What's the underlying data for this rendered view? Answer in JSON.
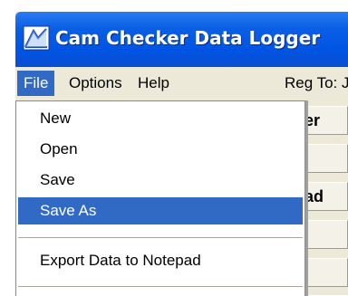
{
  "window": {
    "title": "Cam Checker Data Logger"
  },
  "menubar": {
    "items": [
      {
        "label": "File",
        "active": true
      },
      {
        "label": "Options",
        "active": false
      },
      {
        "label": "Help",
        "active": false
      }
    ],
    "registration": "Reg To: Ji"
  },
  "file_menu": {
    "items": [
      {
        "label": "New",
        "highlighted": false
      },
      {
        "label": "Open",
        "highlighted": false
      },
      {
        "label": "Save",
        "highlighted": false
      },
      {
        "label": "Save As",
        "highlighted": true
      },
      {
        "label": "Export Data to Notepad",
        "highlighted": false
      }
    ]
  },
  "background_cells": [
    {
      "text": "er"
    },
    {
      "text": ""
    },
    {
      "text": "ad"
    },
    {
      "text": ""
    },
    {
      "text": ""
    }
  ],
  "colors": {
    "titlebar": "#0054e3",
    "menu_highlight": "#316ac5",
    "window_bg": "#ece9d8"
  }
}
